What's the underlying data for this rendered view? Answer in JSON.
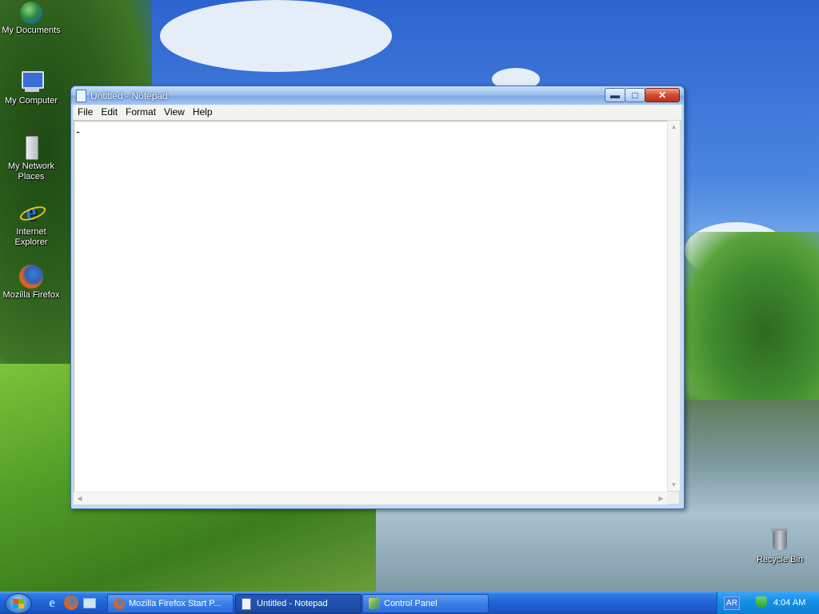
{
  "desktop": {
    "icons": [
      {
        "label": "My Documents",
        "icon": "globe-documents-icon"
      },
      {
        "label": "My Computer",
        "icon": "computer-icon"
      },
      {
        "label": "My Network Places",
        "icon": "network-server-icon"
      },
      {
        "label": "Internet Explorer",
        "icon": "internet-explorer-icon"
      },
      {
        "label": "Mozilla Firefox",
        "icon": "firefox-icon"
      },
      {
        "label": "Recycle Bin",
        "icon": "recycle-bin-icon"
      }
    ]
  },
  "window": {
    "title": "Untitled - Notepad",
    "controls": {
      "minimize": "▬",
      "maximize": "□",
      "close": "✕"
    },
    "menu": [
      "File",
      "Edit",
      "Format",
      "View",
      "Help"
    ],
    "content": "ـ",
    "scroll_arrows": {
      "up": "▲",
      "down": "▼",
      "left": "◀",
      "right": "▶"
    }
  },
  "taskbar": {
    "quick_launch": [
      "internet-explorer-icon",
      "firefox-icon",
      "show-desktop-icon"
    ],
    "tasks": [
      {
        "label": "Mozilla Firefox Start P...",
        "active": false
      },
      {
        "label": "Untitled - Notepad",
        "active": true
      },
      {
        "label": "Control Panel",
        "active": false
      }
    ],
    "tray": {
      "language": "AR",
      "time": "4:04 AM"
    }
  }
}
